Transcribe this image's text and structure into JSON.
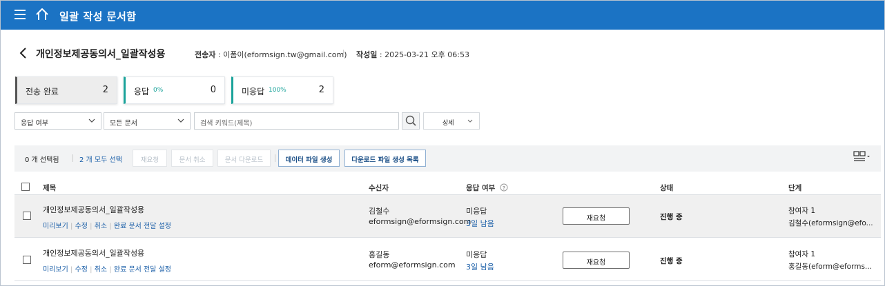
{
  "app": {
    "title": "일괄 작성 문서함"
  },
  "doc": {
    "title": "개인정보제공동의서_일괄작성용",
    "sender_label": "전송자",
    "sender_value": "이폼이(eformsign.tw@gmail.com)",
    "created_label": "작성일",
    "created_value": "2025-03-21 오후 06:53"
  },
  "stats": [
    {
      "label": "전송 완료",
      "percent": "",
      "count": "2"
    },
    {
      "label": "응답",
      "percent": "0%",
      "count": "0"
    },
    {
      "label": "미응답",
      "percent": "100%",
      "count": "2"
    }
  ],
  "filters": {
    "response_select": "응답 여부",
    "docs_select": "모든 문서",
    "search_placeholder": "검색 키워드(제목)",
    "detail_label": "상세"
  },
  "toolbar": {
    "selected_count": "0 개 선택됨",
    "select_all": "2 개 모두 선택",
    "resend": "재요청",
    "cancel": "문서 취소",
    "download": "문서 다운로드",
    "create_data": "데이터 파일 생성",
    "download_list": "다운로드 파일 생성 목록"
  },
  "table": {
    "headers": {
      "title": "제목",
      "recipient": "수신자",
      "response": "응답 여부",
      "status": "상태",
      "stage": "단계"
    },
    "actions": {
      "preview": "미리보기",
      "edit": "수정",
      "cancel": "취소",
      "setting": "완료 문서 전달 설정",
      "resend": "재요청"
    },
    "rows": [
      {
        "title": "개인정보제공동의서_일괄작성용",
        "recipient_name": "김철수",
        "recipient_email": "eformsign@eformsign.com",
        "response": "미응답",
        "remaining": "3일 남음",
        "status": "진행 중",
        "stage_label": "참여자 1",
        "stage_value": "김철수(eformsign@efo..."
      },
      {
        "title": "개인정보제공동의서_일괄작성용",
        "recipient_name": "홍길동",
        "recipient_email": "eform@eformsign.com",
        "response": "미응답",
        "remaining": "3일 남음",
        "status": "진행 중",
        "stage_label": "참여자 1",
        "stage_value": "홍길동(eform@eforms..."
      }
    ]
  },
  "colors": {
    "header_bg": "#1b73c4",
    "accent_teal": "#1aa39a",
    "link_blue": "#1b5fa8"
  }
}
